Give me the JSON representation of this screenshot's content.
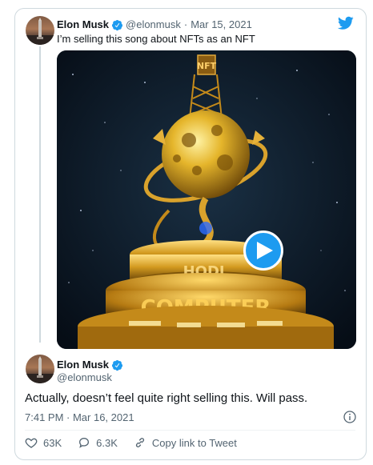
{
  "quoted_tweet": {
    "author_name": "Elon Musk",
    "author_handle": "@elonmusk",
    "separator": "·",
    "date": "Mar 15, 2021",
    "text": "I’m selling this song about NFTs as an NFT",
    "media": {
      "sign_text": "NFT",
      "ring_text": "HODL",
      "base_text": "COMPUTER"
    }
  },
  "reply_tweet": {
    "author_name": "Elon Musk",
    "author_handle": "@elonmusk",
    "text": "Actually, doesn’t feel quite right selling this. Will pass.",
    "timestamp": "7:41 PM · Mar 16, 2021"
  },
  "actions": {
    "likes": "63K",
    "replies": "6.3K",
    "copy_link_label": "Copy link to Tweet"
  },
  "colors": {
    "twitter_blue": "#1d9bf0",
    "verified_blue": "#1d9bf0",
    "muted_text": "#536471"
  },
  "icons": [
    "twitter-logo",
    "verified-badge",
    "play-icon",
    "info-icon",
    "heart-icon",
    "reply-icon",
    "link-icon"
  ]
}
